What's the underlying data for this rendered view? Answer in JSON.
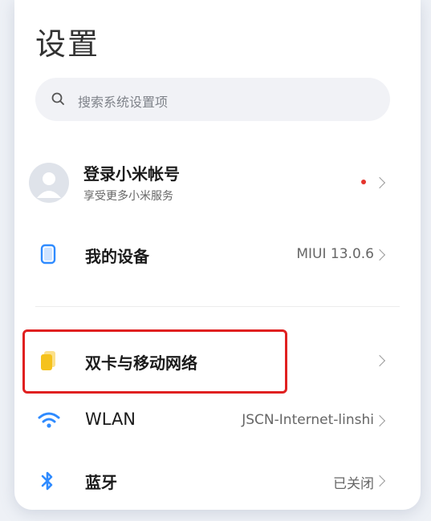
{
  "header": {
    "title": "设置"
  },
  "search": {
    "placeholder": "搜索系统设置项",
    "icon": "search-icon"
  },
  "account": {
    "title": "登录小米帐号",
    "subtitle": "享受更多小米服务",
    "notification_dot_color": "#e5342d"
  },
  "items": [
    {
      "label": "我的设备",
      "value": "MIUI 13.0.6",
      "icon": "device-icon"
    },
    {
      "label": "双卡与移动网络",
      "value": "",
      "icon": "sim-card-icon",
      "highlighted": true
    },
    {
      "label": "WLAN",
      "value": "JSCN-Internet-linshi",
      "icon": "wifi-icon"
    },
    {
      "label": "蓝牙",
      "value": "已关闭",
      "icon": "bluetooth-icon"
    }
  ],
  "colors": {
    "accent_blue": "#2f8bff",
    "sim_yellow": "#f5c21c",
    "highlight_red": "#e02020"
  }
}
